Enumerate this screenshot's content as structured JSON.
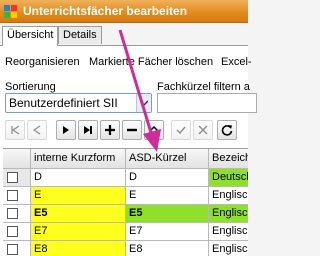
{
  "window": {
    "title": "Unterrichtsfächer bearbeiten"
  },
  "tabs": [
    {
      "label": "Übersicht",
      "active": true
    },
    {
      "label": "Details",
      "active": false
    }
  ],
  "actions": {
    "reorganize": "Reorganisieren",
    "delete_marked": "Markierte Fächer löschen",
    "excel": "Excel-"
  },
  "sort": {
    "label": "Sortierung",
    "value": "Benutzerdefiniert SII"
  },
  "filter": {
    "label": "Fachkürzel filtern a",
    "value": ""
  },
  "table": {
    "columns": [
      "interne Kurzform",
      "ASD-Kürzel",
      "Bezeichnung"
    ],
    "rows": [
      {
        "kurz": "D",
        "asd": "D",
        "bez": "Deutsch",
        "bold": false,
        "kurz_bg": "#ffffff",
        "asd_bg": "#ffffff",
        "bez_bg": "#8ee02a",
        "selected": true
      },
      {
        "kurz": "E",
        "asd": "E",
        "bez": "Englisch",
        "bold": false,
        "kurz_bg": "#ffff1e",
        "asd_bg": "#ffffff",
        "bez_bg": "#ffffff",
        "selected": false
      },
      {
        "kurz": "E5",
        "asd": "E5",
        "bez": "Englisch, Be",
        "bold": true,
        "kurz_bg": "#ffff1e",
        "asd_bg": "#8ee02a",
        "bez_bg": "#8ee02a",
        "selected": false
      },
      {
        "kurz": "E7",
        "asd": "E7",
        "bez": "Englisch, Be",
        "bold": false,
        "kurz_bg": "#ffff1e",
        "asd_bg": "#ffffff",
        "bez_bg": "#ffffff",
        "selected": false
      },
      {
        "kurz": "E8",
        "asd": "E8",
        "bez": "Englisch, Be",
        "bold": false,
        "kurz_bg": "#ffff1e",
        "asd_bg": "#ffffff",
        "bez_bg": "#ffffff",
        "selected": false
      }
    ]
  },
  "colors": {
    "titlebar": "#e38c1e",
    "highlight_yellow": "#ffff1e",
    "highlight_green": "#8ee02a",
    "annotation_arrow": "#d02b9c"
  },
  "icons": {
    "toolbar": [
      "first-icon",
      "prev-icon",
      "next-icon",
      "last-icon",
      "add-icon",
      "delete-icon",
      "save-icon",
      "confirm-icon",
      "cancel-icon",
      "refresh-icon"
    ]
  }
}
